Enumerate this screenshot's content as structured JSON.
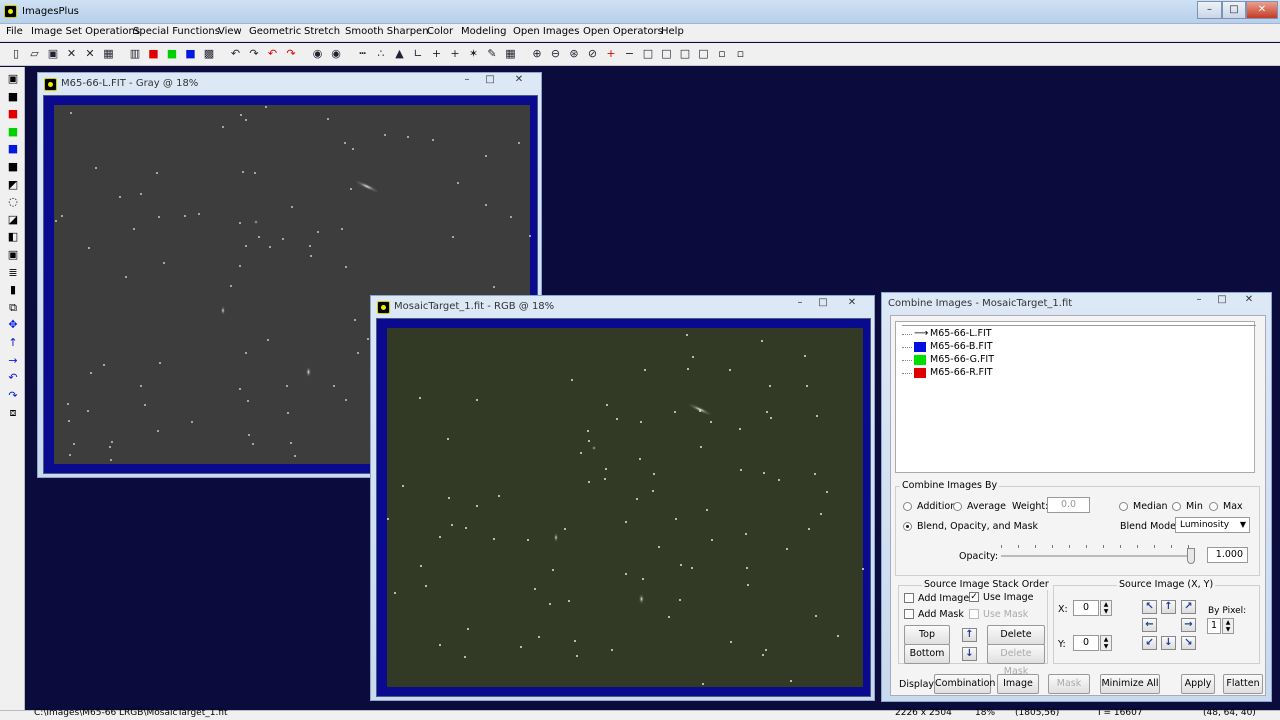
{
  "app": {
    "title": "ImagesPlus"
  },
  "caption_buttons": {
    "minimize": "–",
    "maximize": "□",
    "close": "✕"
  },
  "menu": [
    "File",
    "Image Set Operations",
    "Special Functions",
    "View",
    "Geometric",
    "Stretch",
    "Smooth Sharpen",
    "Color",
    "Modeling",
    "Open Images",
    "Open Operators",
    "Help"
  ],
  "toolbar": {
    "icons": [
      "new-icon",
      "open-icon",
      "save-icon",
      "close-x-icon",
      "check-icon",
      "copy-icon",
      "rgb-channels-icon",
      "red-channel-icon",
      "green-channel-icon",
      "blue-channel-icon",
      "palette-icon",
      "undo-icon",
      "redo-icon",
      "undo-red-icon",
      "redo-red-icon",
      "circle-dot-icon",
      "target-icon",
      "dots-icon",
      "scatter-icon",
      "triangle-icon",
      "curve-icon",
      "cross-icon",
      "grid-icon",
      "sparkle-icon",
      "pencil-icon",
      "table-icon",
      "zoom-in-icon",
      "zoom-out-icon",
      "zoom-fit-icon",
      "zoom-reset-icon",
      "plus-box-icon",
      "minus-box-icon",
      "square-1-icon",
      "square-2-icon",
      "square-3-icon",
      "square-4-icon",
      "small-square-icon",
      "small-square-2-icon"
    ],
    "glyphs": [
      "▯",
      "▱",
      "▣",
      "✕",
      "✕",
      "▦",
      "▥",
      "■",
      "■",
      "■",
      "▩",
      "↶",
      "↷",
      "↶",
      "↷",
      "◉",
      "◉",
      "┅",
      "∴",
      "▲",
      "∟",
      "+",
      "+",
      "✶",
      "✎",
      "▦",
      "⊕",
      "⊖",
      "⊛",
      "⊘",
      "+",
      "−",
      "□",
      "□",
      "□",
      "□",
      "▫",
      "▫"
    ],
    "colors": {
      "red": "#e00000",
      "green": "#00d000",
      "blue": "#0018e0"
    }
  },
  "left_toolbar": {
    "icons": [
      "save-icon",
      "black-square-icon",
      "red-black-icon",
      "green-black-icon",
      "blue-black-icon",
      "rgb-stack-icon",
      "mask-icon",
      "brightness-icon",
      "contrast-icon",
      "gray-icon",
      "frame-icon",
      "bars-icon",
      "black-bar-icon",
      "crop-icon",
      "move-icon",
      "up-arrow-icon",
      "right-arrow-icon",
      "rotate-left-icon",
      "rotate-right-icon",
      "flip-icon"
    ],
    "glyphs": [
      "▣",
      "■",
      "■",
      "■",
      "■",
      "■",
      "◩",
      "◌",
      "◪",
      "◧",
      "▣",
      "≣",
      "▮",
      "⧉",
      "✥",
      "↑",
      "→",
      "↶",
      "↷",
      "⧈"
    ]
  },
  "window_gray": {
    "title": "M65-66-L.FIT - Gray @ 18%"
  },
  "window_rgb": {
    "title": "MosaicTarget_1.fit - RGB @ 18%"
  },
  "dialog": {
    "title": "Combine Images - MosaicTarget_1.fit",
    "layers": [
      {
        "name": "M65-66-L.FIT",
        "swatch": "arrow"
      },
      {
        "name": "M65-66-B.FIT",
        "swatch": "#0010e0"
      },
      {
        "name": "M65-66-G.FIT",
        "swatch": "#00e000"
      },
      {
        "name": "M65-66-R.FIT",
        "swatch": "#e00000"
      }
    ],
    "combine_by_label": "Combine Images By",
    "addition": "Addition",
    "average": "Average",
    "weight_label": "Weight:",
    "weight_value": "0.0",
    "median": "Median",
    "min": "Min",
    "max": "Max",
    "blend_option": "Blend, Opacity, and Mask",
    "blend_mode_label": "Blend Mode:",
    "blend_mode_value": "Luminosity",
    "opacity_label": "Opacity:",
    "opacity_value": "1.000",
    "opacity_fraction": 1.0,
    "stack_order_label": "Source Image Stack Order",
    "add_image": "Add Image",
    "use_image": "Use Image",
    "add_mask": "Add Mask",
    "use_mask": "Use Mask",
    "top_btn": "Top",
    "bottom_btn": "Bottom",
    "delete_image": "Delete Image",
    "delete_mask": "Delete Mask",
    "source_xy_label": "Source Image (X, Y)",
    "x_label": "X:",
    "x_value": "0",
    "y_label": "Y:",
    "y_value": "0",
    "by_pixel_label": "By Pixel:",
    "by_pixel_value": "1",
    "display_label": "Display:",
    "combination_btn": "Combination",
    "image_btn": "Image",
    "mask_btn": "Mask",
    "minimize_all_btn": "Minimize All",
    "apply_btn": "Apply",
    "flatten_btn": "Flatten"
  },
  "status": {
    "path": "C:\\Images\\M65-66 LRGB\\MosaicTarget_1.fit",
    "dims": "2226 x 2504",
    "zoom": "18%",
    "coords": "(1805,56)",
    "intensity": "I = 16607",
    "rgb": "(48, 64, 40)"
  }
}
